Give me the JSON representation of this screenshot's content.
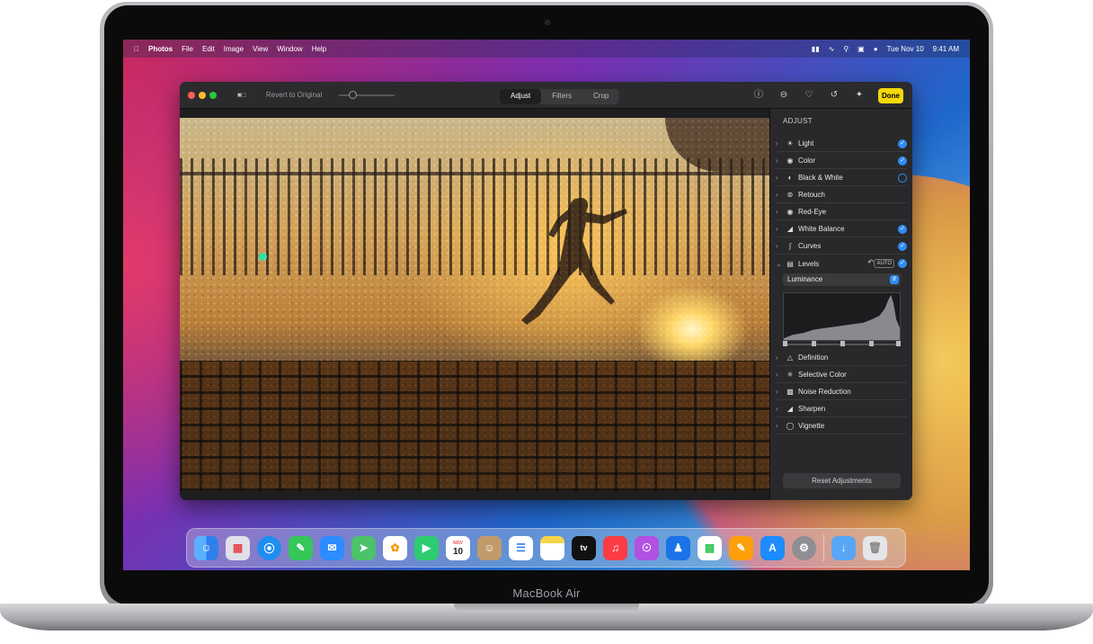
{
  "device": {
    "label": "MacBook Air"
  },
  "menubar": {
    "app": "Photos",
    "items": [
      "File",
      "Edit",
      "Image",
      "View",
      "Window",
      "Help"
    ],
    "date": "Tue Nov 10",
    "time": "9:41 AM",
    "status_icons": [
      "wifi-icon",
      "search-icon",
      "control-center-icon",
      "siri-icon"
    ]
  },
  "window": {
    "toolbar": {
      "revert_label": "Revert to Original",
      "tabs": [
        "Adjust",
        "Filters",
        "Crop"
      ],
      "active_tab": "Adjust",
      "done_label": "Done",
      "icons": [
        "info-icon",
        "minus-icon",
        "heart-icon",
        "rotate-icon",
        "enhance-icon"
      ]
    },
    "sidebar": {
      "title": "ADJUST",
      "items": [
        {
          "label": "Light",
          "icon": "sun-icon",
          "checked": true
        },
        {
          "label": "Color",
          "icon": "color-wheel-icon",
          "checked": true
        },
        {
          "label": "Black & White",
          "icon": "half-circle-icon",
          "checked": false
        },
        {
          "label": "Retouch",
          "icon": "bandage-icon",
          "checked": null
        },
        {
          "label": "Red-Eye",
          "icon": "eye-icon",
          "checked": null
        },
        {
          "label": "White Balance",
          "icon": "white-balance-icon",
          "checked": true
        },
        {
          "label": "Curves",
          "icon": "curves-icon",
          "checked": true
        },
        {
          "label": "Levels",
          "icon": "levels-icon",
          "checked": true,
          "expanded": true,
          "auto_label": "AUTO"
        },
        {
          "label": "Definition",
          "icon": "triangle-icon",
          "checked": null
        },
        {
          "label": "Selective Color",
          "icon": "selective-color-icon",
          "checked": null
        },
        {
          "label": "Noise Reduction",
          "icon": "noise-icon",
          "checked": null
        },
        {
          "label": "Sharpen",
          "icon": "sharpen-icon",
          "checked": null
        },
        {
          "label": "Vignette",
          "icon": "vignette-icon",
          "checked": null
        }
      ],
      "levels": {
        "channel": "Luminance"
      },
      "reset_label": "Reset Adjustments"
    }
  },
  "dock": {
    "apps": [
      {
        "name": "finder-icon",
        "color": "#2f80ed"
      },
      {
        "name": "launchpad-icon",
        "color": "#e0e0e8"
      },
      {
        "name": "safari-icon",
        "color": "#1f8ef1"
      },
      {
        "name": "messages-icon",
        "color": "#34c759"
      },
      {
        "name": "mail-icon",
        "color": "#2d8cff"
      },
      {
        "name": "maps-icon",
        "color": "#4cc26a"
      },
      {
        "name": "photos-icon",
        "color": "#ffffff"
      },
      {
        "name": "facetime-icon",
        "color": "#2ecc71"
      },
      {
        "name": "calendar-icon",
        "color": "#ffffff",
        "text_top": "NOV",
        "text": "10"
      },
      {
        "name": "contacts-icon",
        "color": "#c19a6b"
      },
      {
        "name": "reminders-icon",
        "color": "#ffffff"
      },
      {
        "name": "notes-icon",
        "color": "#f7d54a"
      },
      {
        "name": "tv-icon",
        "color": "#111111",
        "text": "tv"
      },
      {
        "name": "music-icon",
        "color": "#fc3c44"
      },
      {
        "name": "podcasts-icon",
        "color": "#b150e2"
      },
      {
        "name": "keynote-icon",
        "color": "#1a73e8"
      },
      {
        "name": "numbers-icon",
        "color": "#ffffff"
      },
      {
        "name": "pages-icon",
        "color": "#ff9f0a"
      },
      {
        "name": "app-store-icon",
        "color": "#1c8cff"
      },
      {
        "name": "system-preferences-icon",
        "color": "#8e8e93"
      },
      {
        "name": "downloads-folder-icon",
        "color": "#58a6f5"
      },
      {
        "name": "trash-icon",
        "color": "#e5e5ea"
      }
    ]
  }
}
